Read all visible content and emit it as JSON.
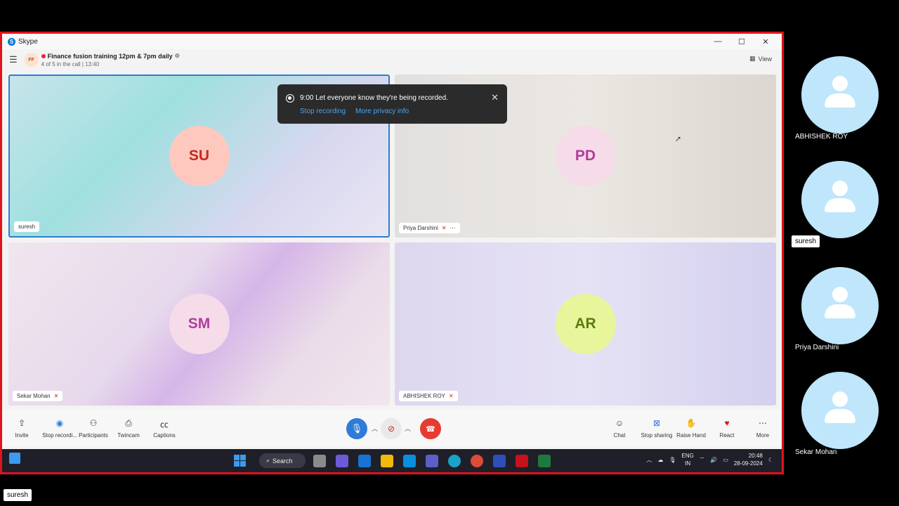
{
  "window": {
    "app_name": "Skype",
    "controls": [
      "—",
      "☐",
      "✕"
    ]
  },
  "call": {
    "avatar_initials": "FF",
    "title": "Finance fusion training 12pm & 7pm daily",
    "subtitle": "4 of 5 in the call | 13:40",
    "view_label": "View"
  },
  "tiles": [
    {
      "initials": "SU",
      "name": "suresh"
    },
    {
      "initials": "PD",
      "name": "Priya Darshini"
    },
    {
      "initials": "SM",
      "name": "Sekar Mohan"
    },
    {
      "initials": "AR",
      "name": "ABHISHEK ROY"
    }
  ],
  "toast": {
    "message": "9:00 Let everyone know they're being recorded.",
    "stop_link": "Stop recording",
    "privacy_link": "More privacy info"
  },
  "toolbar": {
    "left": [
      {
        "label": "Invite",
        "icon": "share-icon"
      },
      {
        "label": "Stop recordi...",
        "icon": "record-icon"
      },
      {
        "label": "Participants",
        "icon": "participants-icon"
      },
      {
        "label": "Twincam",
        "icon": "twincam-icon"
      },
      {
        "label": "Captions",
        "icon": "captions-icon"
      }
    ],
    "right": [
      {
        "label": "Chat",
        "icon": "chat-icon"
      },
      {
        "label": "Stop sharing",
        "icon": "screen-share-icon"
      },
      {
        "label": "Raise Hand",
        "icon": "hand-icon"
      },
      {
        "label": "React",
        "icon": "heart-icon"
      },
      {
        "label": "More",
        "icon": "more-icon"
      }
    ]
  },
  "taskbar": {
    "search_label": "Search",
    "lang_top": "ENG",
    "lang_bottom": "IN",
    "time": "20:48",
    "date": "28-09-2024"
  },
  "sidebar": {
    "participants": [
      "ABHISHEK ROY",
      "suresh",
      "Priya Darshini",
      "Sekar Mohan"
    ]
  },
  "bottom_badge": "suresh",
  "colors": {
    "frame_border": "#e0141b",
    "accent": "#2f7bd8",
    "end_call": "#e43b32"
  }
}
